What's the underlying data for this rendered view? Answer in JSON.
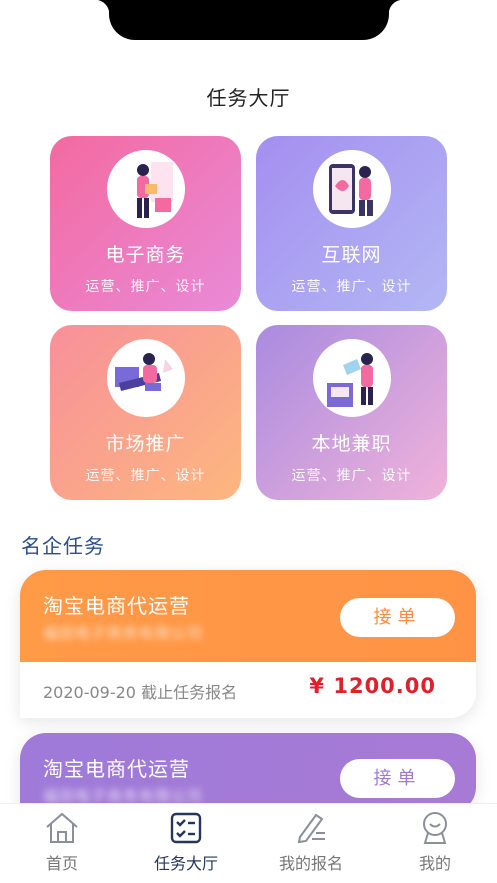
{
  "header": {
    "title": "任务大厅"
  },
  "categories": [
    {
      "name": "电子商务",
      "sub": "运营、推广、设计",
      "icon": "ecommerce-illustration"
    },
    {
      "name": "互联网",
      "sub": "运营、推广、设计",
      "icon": "internet-illustration"
    },
    {
      "name": "市场推广",
      "sub": "运营、推广、设计",
      "icon": "marketing-illustration"
    },
    {
      "name": "本地兼职",
      "sub": "运营、推广、设计",
      "icon": "local-parttime-illustration"
    }
  ],
  "section": {
    "title": "名企任务"
  },
  "tasks": [
    {
      "job": "淘宝电商代运营",
      "company": "福田电子商务有限公司",
      "accept": "接单",
      "date": "2020-09-20 截止任务报名",
      "price": "¥ 1200.00",
      "color": "#ff9a47"
    },
    {
      "job": "淘宝电商代运营",
      "company": "福田电子商务有限公司",
      "accept": "接单",
      "color": "#a07ad6"
    }
  ],
  "tabbar": {
    "items": [
      {
        "label": "首页",
        "icon": "home-icon"
      },
      {
        "label": "任务大厅",
        "icon": "task-list-icon",
        "active": true
      },
      {
        "label": "我的报名",
        "icon": "edit-icon"
      },
      {
        "label": "我的",
        "icon": "profile-icon"
      }
    ]
  }
}
